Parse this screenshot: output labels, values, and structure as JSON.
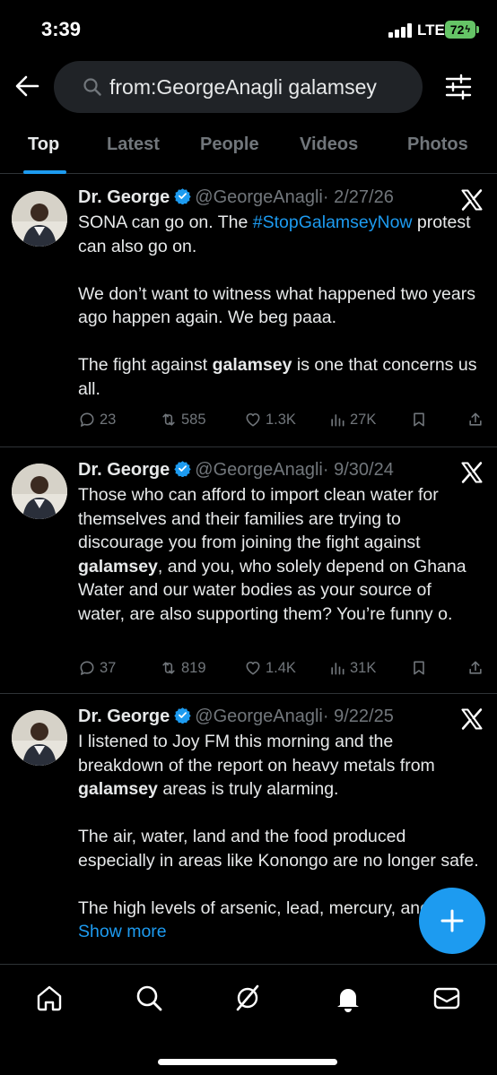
{
  "status": {
    "time": "3:39",
    "network": "LTE",
    "battery": "72"
  },
  "search": {
    "query": "from:GeorgeAnagli galamsey"
  },
  "tabs": [
    {
      "label": "Top",
      "active": true
    },
    {
      "label": "Latest",
      "active": false
    },
    {
      "label": "People",
      "active": false
    },
    {
      "label": "Videos",
      "active": false
    },
    {
      "label": "Photos",
      "active": false
    }
  ],
  "tweets": [
    {
      "name": "Dr. George",
      "handle": "@GeorgeAnagli",
      "date": "· 2/27/26",
      "p1_a": "SONA can go on. The ",
      "p1_tag": "#StopGalamseyNow",
      "p1_b": " protest can also go on.",
      "p2": "We don’t want to witness what happened two years ago happen again. We beg paaa.",
      "p3_a": "The fight against ",
      "p3_bold": "galamsey",
      "p3_b": " is one that concerns us all.",
      "replies": "23",
      "reposts": "585",
      "likes": "1.3K",
      "views": "27K"
    },
    {
      "name": "Dr. George",
      "handle": "@GeorgeAnagli",
      "date": "· 9/30/24",
      "p1_a": "Those who can afford to import clean water for themselves and their families are trying to discourage you from joining the fight against ",
      "p1_bold": "galamsey",
      "p1_b": ", and you, who solely depend on Ghana Water and our water bodies as your source of water, are also supporting them? You’re funny o.",
      "replies": "37",
      "reposts": "819",
      "likes": "1.4K",
      "views": "31K"
    },
    {
      "name": "Dr. George",
      "handle": "@GeorgeAnagli",
      "date": "· 9/22/25",
      "p1_a": "I listened to Joy FM this morning and the breakdown of the report on heavy metals from ",
      "p1_bold": "galamsey",
      "p1_b": " areas is truly alarming.",
      "p2": "The air, water, land and the food produced especially in areas like Konongo are no longer safe.",
      "p3": "The high levels of arsenic, lead, mercury, and other ",
      "show_more": "Show more"
    }
  ],
  "colors": {
    "accent": "#1d9bf0",
    "muted": "#71767b",
    "background": "#000000",
    "battery": "#65c466"
  },
  "icons": [
    "back-arrow-icon",
    "search-icon",
    "filter-icon",
    "verified-icon",
    "x-logo-icon",
    "reply-icon",
    "repost-icon",
    "like-icon",
    "views-icon",
    "bookmark-icon",
    "share-icon",
    "compose-icon",
    "home-icon",
    "grok-icon",
    "notifications-icon",
    "messages-icon"
  ]
}
